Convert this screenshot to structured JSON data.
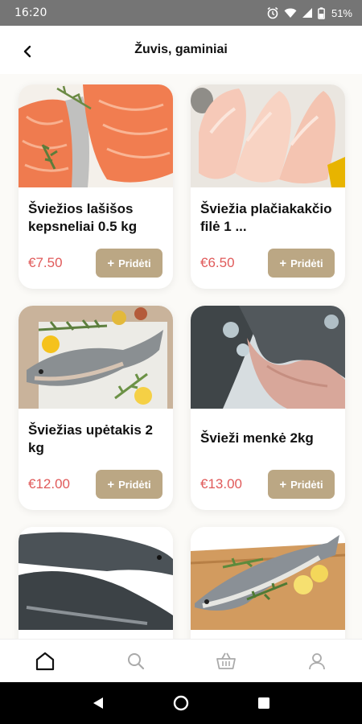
{
  "status_bar": {
    "time": "16:20",
    "battery": "51%"
  },
  "header": {
    "title": "Žuvis, gaminiai"
  },
  "add_label": "Pridėti",
  "products": [
    {
      "name": "Šviežios lašišos kepsneliai 0.5 kg",
      "price": "€7.50",
      "image": "salmon-steaks-image"
    },
    {
      "name": "Šviežia plačiakakčio filė 1 ...",
      "price": "€6.50",
      "image": "fish-fillet-image"
    },
    {
      "name": "Šviežias upėtakis 2 kg",
      "price": "€12.00",
      "image": "trout-image"
    },
    {
      "name": "Švieži menkė 2kg",
      "price": "€13.00",
      "image": "cod-image"
    },
    {
      "name": "",
      "price": "",
      "image": "catfish-image"
    },
    {
      "name": "",
      "price": "",
      "image": "zander-image"
    }
  ],
  "bottom_nav": [
    "home-icon",
    "search-icon",
    "basket-icon",
    "profile-icon"
  ],
  "colors": {
    "accent": "#bba784",
    "price": "#e05a5a",
    "status_bar": "#757575"
  }
}
